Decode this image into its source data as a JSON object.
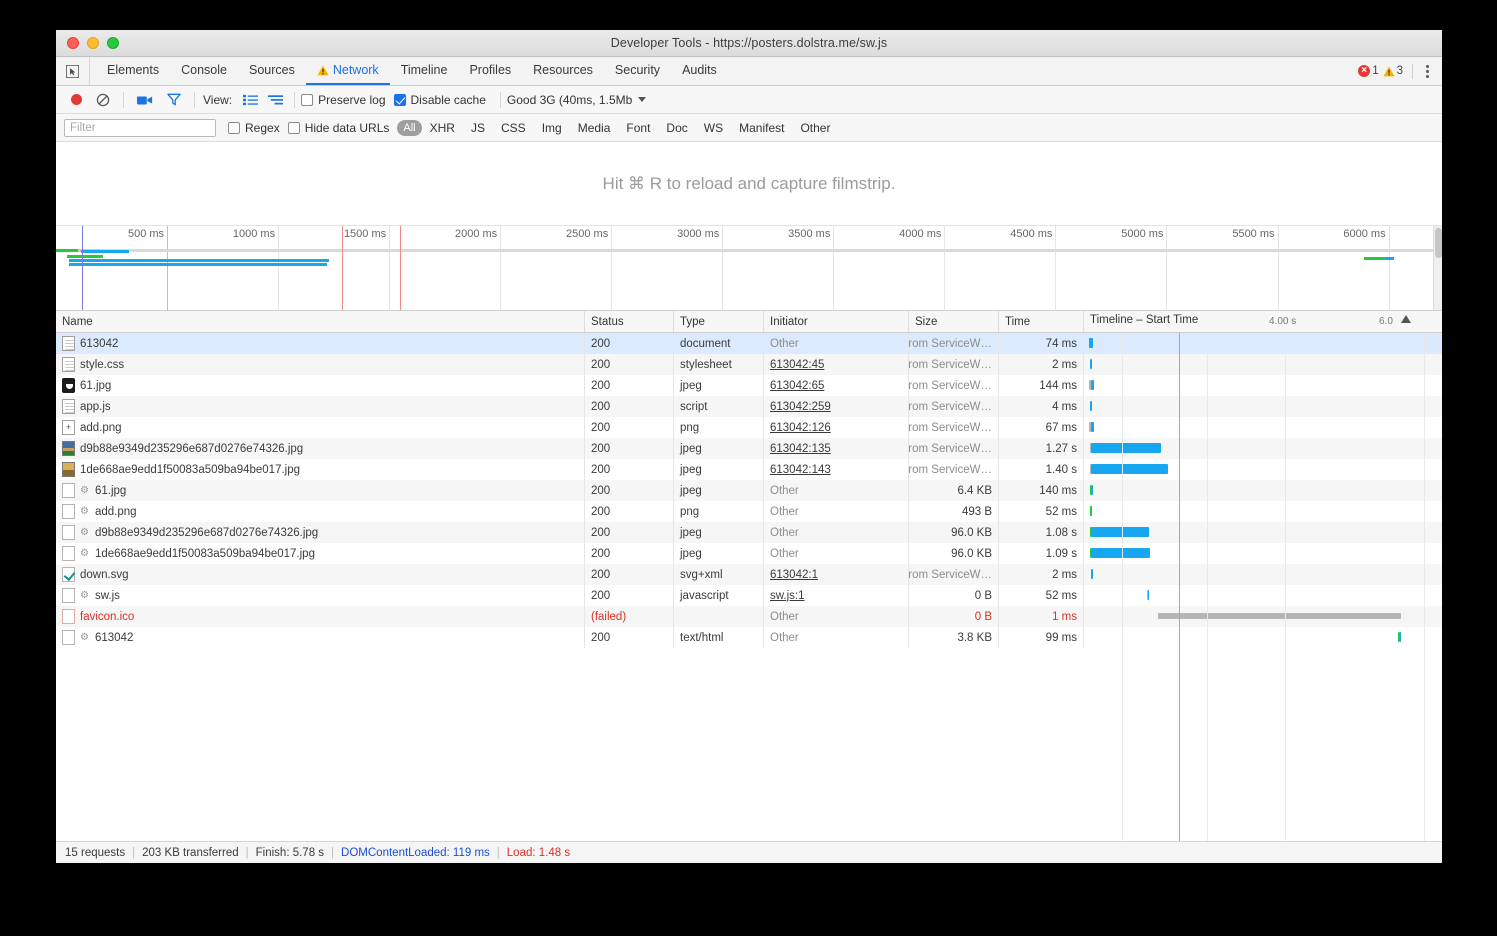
{
  "window": {
    "title": "Developer Tools - https://posters.dolstra.me/sw.js",
    "traffic_lights": [
      "close",
      "minimize",
      "zoom"
    ]
  },
  "tabs": {
    "inspect_icon": "cursor-inspect-icon",
    "items": [
      {
        "label": "Elements",
        "active": false,
        "warn": false
      },
      {
        "label": "Console",
        "active": false,
        "warn": false
      },
      {
        "label": "Sources",
        "active": false,
        "warn": false
      },
      {
        "label": "Network",
        "active": true,
        "warn": true
      },
      {
        "label": "Timeline",
        "active": false,
        "warn": false
      },
      {
        "label": "Profiles",
        "active": false,
        "warn": false
      },
      {
        "label": "Resources",
        "active": false,
        "warn": false
      },
      {
        "label": "Security",
        "active": false,
        "warn": false
      },
      {
        "label": "Audits",
        "active": false,
        "warn": false
      }
    ],
    "error_count": "1",
    "warning_count": "3"
  },
  "toolbar": {
    "record_icon": "record-dot-icon",
    "clear_icon": "clear-no-entry-icon",
    "camera_icon": "filmstrip-camera-icon",
    "filter_icon": "funnel-filter-icon",
    "view_label": "View:",
    "view_list_icon": "list-view-icon",
    "view_waterfall_icon": "waterfall-view-icon",
    "preserve_log_label": "Preserve log",
    "preserve_log_checked": false,
    "disable_cache_label": "Disable cache",
    "disable_cache_checked": true,
    "throttle_value": "Good 3G (40ms, 1.5Mb",
    "throttle_caret_icon": "chevron-down-icon"
  },
  "filterbar": {
    "placeholder": "Filter",
    "value": "",
    "regex_label": "Regex",
    "regex_checked": false,
    "hide_data_urls_label": "Hide data URLs",
    "hide_data_urls_checked": false,
    "types": [
      "All",
      "XHR",
      "JS",
      "CSS",
      "Img",
      "Media",
      "Font",
      "Doc",
      "WS",
      "Manifest",
      "Other"
    ],
    "selected_type": "All"
  },
  "filmstrip": {
    "message": "Hit ⌘ R to reload and capture filmstrip."
  },
  "overview": {
    "ticks": [
      "500 ms",
      "1000 ms",
      "1500 ms",
      "2000 ms",
      "2500 ms",
      "3000 ms",
      "3500 ms",
      "4000 ms",
      "4500 ms",
      "5000 ms",
      "5500 ms",
      "6000 ms"
    ],
    "dcl_marker_ms": 119,
    "load_marker_ms": 1480
  },
  "table": {
    "columns": [
      {
        "key": "name",
        "label": "Name"
      },
      {
        "key": "status",
        "label": "Status"
      },
      {
        "key": "type",
        "label": "Type"
      },
      {
        "key": "initiator",
        "label": "Initiator"
      },
      {
        "key": "size",
        "label": "Size"
      },
      {
        "key": "time",
        "label": "Time"
      },
      {
        "key": "timeline",
        "label": "Timeline – Start Time"
      }
    ],
    "timeline_ticks": [
      "4.00 s",
      "6.0"
    ],
    "rows": [
      {
        "icon": "doc",
        "sw": false,
        "name": "613042",
        "status": "200",
        "type": "document",
        "initiator": "Other",
        "initiator_link": false,
        "size": "(from ServiceW…",
        "size_muted": true,
        "time": "74 ms",
        "selected": true,
        "bar": {
          "start": 0.5,
          "queue": 0.9,
          "wait": 0,
          "load": 3.2,
          "color": "b"
        }
      },
      {
        "icon": "doc",
        "sw": false,
        "name": "style.css",
        "status": "200",
        "type": "stylesheet",
        "initiator": "613042:45",
        "initiator_link": true,
        "size": "(from ServiceW…",
        "size_muted": true,
        "time": "2 ms",
        "selected": false,
        "bar": {
          "start": 2.2,
          "queue": 0,
          "wait": 0,
          "load": 2.2,
          "color": "b"
        }
      },
      {
        "icon": "img-dark",
        "sw": false,
        "name": "61.jpg",
        "status": "200",
        "type": "jpeg",
        "initiator": "613042:65",
        "initiator_link": true,
        "size": "(from ServiceW…",
        "size_muted": true,
        "time": "144 ms",
        "selected": false,
        "bar": {
          "start": 1.4,
          "queue": 1.6,
          "wait": 0,
          "load": 3.4,
          "color": "b"
        }
      },
      {
        "icon": "doc",
        "sw": false,
        "name": "app.js",
        "status": "200",
        "type": "script",
        "initiator": "613042:259",
        "initiator_link": true,
        "size": "(from ServiceW…",
        "size_muted": true,
        "time": "4 ms",
        "selected": false,
        "bar": {
          "start": 2.2,
          "queue": 0,
          "wait": 0,
          "load": 2.3,
          "color": "b"
        }
      },
      {
        "icon": "plus",
        "sw": false,
        "name": "add.png",
        "status": "200",
        "type": "png",
        "initiator": "613042:126",
        "initiator_link": true,
        "size": "(from ServiceW…",
        "size_muted": true,
        "time": "67 ms",
        "selected": false,
        "bar": {
          "start": 1.4,
          "queue": 1.6,
          "wait": 0,
          "load": 2.7,
          "color": "b"
        }
      },
      {
        "icon": "thumb1",
        "sw": false,
        "name": "d9b88e9349d235296e687d0276e74326.jpg",
        "status": "200",
        "type": "jpeg",
        "initiator": "613042:135",
        "initiator_link": true,
        "size": "(from ServiceW…",
        "size_muted": true,
        "time": "1.27 s",
        "selected": false,
        "bar": {
          "start": 1.6,
          "queue": 1.5,
          "wait": 0,
          "load": 70.0,
          "color": "b"
        }
      },
      {
        "icon": "thumb2",
        "sw": false,
        "name": "1de668ae9edd1f50083a509ba94be017.jpg",
        "status": "200",
        "type": "jpeg",
        "initiator": "613042:143",
        "initiator_link": true,
        "size": "(from ServiceW…",
        "size_muted": true,
        "time": "1.40 s",
        "selected": false,
        "bar": {
          "start": 1.6,
          "queue": 1.5,
          "wait": 0,
          "load": 77.0,
          "color": "b"
        }
      },
      {
        "icon": "blank",
        "sw": true,
        "name": "61.jpg",
        "status": "200",
        "type": "jpeg",
        "initiator": "Other",
        "initiator_link": false,
        "size": "6.4 KB",
        "size_muted": false,
        "time": "140 ms",
        "selected": false,
        "bar": {
          "start": 1.5,
          "queue": 0,
          "wait": 1.7,
          "load": 2.0,
          "color": "b"
        }
      },
      {
        "icon": "blank",
        "sw": true,
        "name": "add.png",
        "status": "200",
        "type": "png",
        "initiator": "Other",
        "initiator_link": false,
        "size": "493 B",
        "size_muted": false,
        "time": "52 ms",
        "selected": false,
        "bar": {
          "start": 1.5,
          "queue": 0,
          "wait": 1.4,
          "load": 1.2,
          "color": "b"
        }
      },
      {
        "icon": "blank",
        "sw": true,
        "name": "d9b88e9349d235296e687d0276e74326.jpg",
        "status": "200",
        "type": "jpeg",
        "initiator": "Other",
        "initiator_link": false,
        "size": "96.0 KB",
        "size_muted": false,
        "time": "1.08 s",
        "selected": false,
        "bar": {
          "start": 1.5,
          "queue": 0,
          "wait": 1.8,
          "load": 58.0,
          "color": "b"
        }
      },
      {
        "icon": "blank",
        "sw": true,
        "name": "1de668ae9edd1f50083a509ba94be017.jpg",
        "status": "200",
        "type": "jpeg",
        "initiator": "Other",
        "initiator_link": false,
        "size": "96.0 KB",
        "size_muted": false,
        "time": "1.09 s",
        "selected": false,
        "bar": {
          "start": 1.5,
          "queue": 0,
          "wait": 1.8,
          "load": 59.0,
          "color": "b"
        }
      },
      {
        "icon": "check",
        "sw": false,
        "name": "down.svg",
        "status": "200",
        "type": "svg+xml",
        "initiator": "613042:1",
        "initiator_link": true,
        "size": "(from ServiceW…",
        "size_muted": true,
        "time": "2 ms",
        "selected": false,
        "bar": {
          "start": 2.5,
          "queue": 0,
          "wait": 0,
          "load": 2.2,
          "color": "b"
        }
      },
      {
        "icon": "blank",
        "sw": true,
        "name": "sw.js",
        "status": "200",
        "type": "javascript",
        "initiator": "sw.js:1",
        "initiator_link": true,
        "size": "0 B",
        "size_muted": false,
        "time": "52 ms",
        "selected": false,
        "bar": {
          "start": 58.5,
          "queue": 1.2,
          "wait": 0,
          "load": 1.8,
          "color": "b"
        }
      },
      {
        "icon": "failedbox",
        "sw": false,
        "name": "favicon.ico",
        "status": "(failed)",
        "type": "",
        "initiator": "Other",
        "initiator_link": false,
        "size": "0 B",
        "size_muted": false,
        "time": "1 ms",
        "selected": false,
        "failed": true,
        "bar": {
          "start": 70.0,
          "queue": 0,
          "wait": 0,
          "load": 0,
          "color": "gray-long",
          "gray_len": 243.0
        }
      },
      {
        "icon": "blank",
        "sw": true,
        "name": "613042",
        "status": "200",
        "type": "text/html",
        "initiator": "Other",
        "initiator_link": false,
        "size": "3.8 KB",
        "size_muted": false,
        "time": "99 ms",
        "selected": false,
        "bar": {
          "start": 310.0,
          "queue": 0,
          "wait": 1.6,
          "load": 1.8,
          "color": "b"
        }
      }
    ]
  },
  "statusbar": {
    "requests": "15 requests",
    "transferred": "203 KB transferred",
    "finish": "Finish: 5.78 s",
    "dom_content_loaded": "DOMContentLoaded: 119 ms",
    "load": "Load: 1.48 s",
    "separator": "|"
  },
  "colors": {
    "accent": "#1a73e8",
    "blue_bar": "#17a6f0",
    "green_bar": "#27c93f",
    "gray_bar": "#b6b6b6",
    "error_red": "#d93025",
    "dcl_blue": "#1a4fd0"
  }
}
